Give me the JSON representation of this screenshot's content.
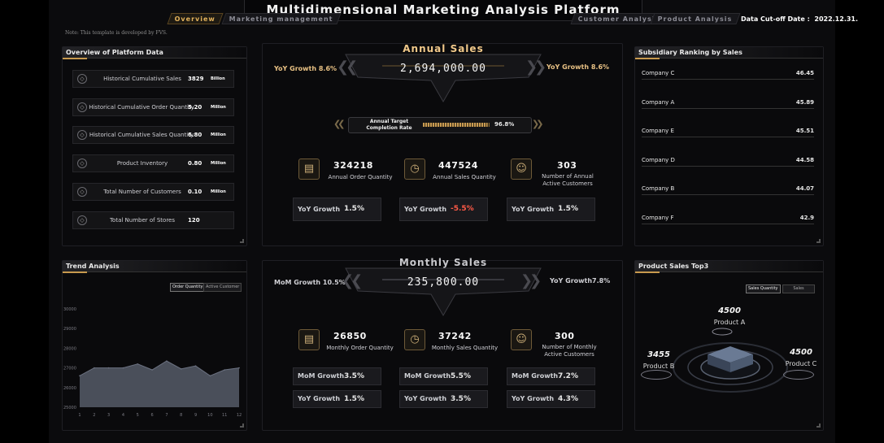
{
  "header": {
    "title": "Multidimensional Marketing Analysis Platform",
    "tabs": [
      "Overview",
      "Marketing management",
      "Customer Analysis",
      "Product Analysis"
    ],
    "cutoff_label": "Data Cut-off Date :",
    "cutoff_value": "2022.12.31.",
    "note": "Note: This template is developed by FVS."
  },
  "overview": {
    "title": "Overview of Platform Data",
    "rows": [
      {
        "label": "Historical Cumulative Sales",
        "value": "3829",
        "unit": "Billion"
      },
      {
        "label": "Historical Cumulative Order Quantity",
        "value": "5.20",
        "unit": "Million"
      },
      {
        "label": "Historical Cumulative Sales Quantity",
        "value": "6.80",
        "unit": "Million"
      },
      {
        "label": "Product Inventory",
        "value": "0.80",
        "unit": "Million"
      },
      {
        "label": "Total Number of Customers",
        "value": "0.10",
        "unit": "Million"
      },
      {
        "label": "Total Number of Stores",
        "value": "120",
        "unit": ""
      }
    ]
  },
  "annual": {
    "title": "Annual Sales",
    "value": "2,694,000.00",
    "left_yoy": "YoY Growth 8.6%",
    "right_yoy": "YoY Growth 8.6%",
    "target_label_1": "Annual Target",
    "target_label_2": "Completion Rate",
    "target_rate": "96.8%",
    "target_fraction": 0.968,
    "stats": [
      {
        "value": "324218",
        "label_1": "Annual Order Quantity",
        "label_2": ""
      },
      {
        "value": "447524",
        "label_1": "Annual Sales Quantity",
        "label_2": ""
      },
      {
        "value": "303",
        "label_1": "Number of Annual",
        "label_2": "Active Customers"
      }
    ],
    "growth": [
      {
        "label": "YoY Growth",
        "value": "1.5%"
      },
      {
        "label": "YoY Growth",
        "value": "-5.5%"
      },
      {
        "label": "YoY Growth",
        "value": "1.5%"
      }
    ]
  },
  "monthly": {
    "title": "Monthly Sales",
    "value": "235,800.00",
    "left_mom": "MoM Growth 10.5%",
    "right_yoy": "YoY Growth7.8%",
    "stats": [
      {
        "value": "26850",
        "label_1": "Monthly Order Quantity",
        "label_2": ""
      },
      {
        "value": "37242",
        "label_1": "Monthly Sales Quantity",
        "label_2": ""
      },
      {
        "value": "300",
        "label_1": "Number of Monthly",
        "label_2": "Active Customers"
      }
    ],
    "mom": [
      {
        "label": "MoM Growth",
        "value": "3.5%"
      },
      {
        "label": "MoM Growth",
        "value": "5.5%"
      },
      {
        "label": "MoM Growth",
        "value": "7.2%"
      }
    ],
    "yoy": [
      {
        "label": "YoY Growth",
        "value": "1.5%"
      },
      {
        "label": "YoY Growth",
        "value": "3.5%"
      },
      {
        "label": "YoY Growth",
        "value": "4.3%"
      }
    ]
  },
  "ranking": {
    "title": "Subsidiary Ranking by Sales",
    "items": [
      {
        "name": "Company C",
        "value": "46.45"
      },
      {
        "name": "Company A",
        "value": "45.89"
      },
      {
        "name": "Company E",
        "value": "45.51"
      },
      {
        "name": "Company D",
        "value": "44.58"
      },
      {
        "name": "Company B",
        "value": "44.07"
      },
      {
        "name": "Company F",
        "value": "42.9"
      }
    ]
  },
  "trend": {
    "title": "Trend Analysis",
    "buttons": [
      "Order Quantity",
      "Active Customer"
    ]
  },
  "chart_data": {
    "type": "area",
    "x": [
      1,
      2,
      3,
      4,
      5,
      6,
      7,
      8,
      9,
      10,
      11,
      12
    ],
    "series": [
      {
        "values": [
          26600,
          27000,
          27000,
          27000,
          27200,
          26900,
          27350,
          26950,
          27100,
          26600,
          26900,
          27000
        ]
      }
    ],
    "ytick_labels": [
      "30000",
      "29000",
      "28000",
      "27000",
      "26000",
      "25000"
    ],
    "xtick_labels": [
      "1",
      "2",
      "3",
      "4",
      "5",
      "6",
      "7",
      "8",
      "9",
      "10",
      "11",
      "12"
    ],
    "title": "",
    "xlabel": "",
    "ylabel": "",
    "ylim": [
      25000,
      30000
    ],
    "grid": false,
    "colors": {
      "fill": "#4a4f5a",
      "line": "#6b7180"
    }
  },
  "top3": {
    "title": "Product Sales Top3",
    "buttons": [
      "Sales Quantity",
      "Sales"
    ],
    "products": [
      {
        "name": "Product A",
        "value": "4500"
      },
      {
        "name": "Product B",
        "value": "3455"
      },
      {
        "name": "Product C",
        "value": "4500"
      }
    ]
  },
  "colors": {
    "accent": "#c89a4e",
    "negative": "#ff5a47",
    "background": "#0b0b0d"
  }
}
